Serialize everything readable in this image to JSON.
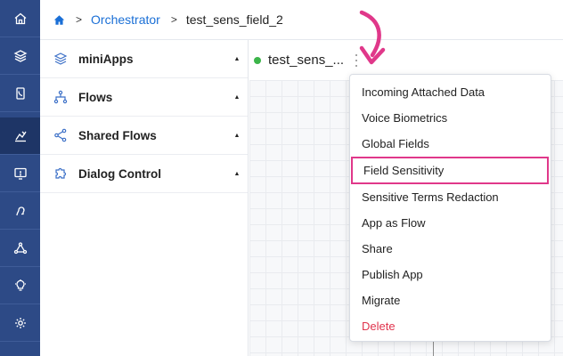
{
  "rail": {
    "items": [
      {
        "icon": "home-icon",
        "active": false
      },
      {
        "icon": "layers-icon",
        "active": false
      },
      {
        "icon": "phone-book-icon",
        "active": false
      },
      {
        "icon": "chart-edit-icon",
        "active": true
      },
      {
        "icon": "monitor-message-icon",
        "active": false
      },
      {
        "icon": "voice-profile-icon",
        "active": false
      },
      {
        "icon": "network-icon",
        "active": false
      },
      {
        "icon": "lightbulb-icon",
        "active": false
      },
      {
        "icon": "settings-cog-icon",
        "active": false
      }
    ]
  },
  "breadcrumb": {
    "home_icon": "home-icon",
    "separator": ">",
    "link": "Orchestrator",
    "current": "test_sens_field_2"
  },
  "panel": {
    "items": [
      {
        "label": "miniApps",
        "icon": "stack-icon",
        "caret": "▲"
      },
      {
        "label": "Flows",
        "icon": "flow-icon",
        "caret": "▲"
      },
      {
        "label": "Shared Flows",
        "icon": "share-icon",
        "caret": "▲"
      },
      {
        "label": "Dialog Control",
        "icon": "puzzle-icon",
        "caret": "▲"
      }
    ]
  },
  "app": {
    "title": "test_sens_...",
    "status_color": "#3cb54a"
  },
  "menu": {
    "items": [
      {
        "label": "Incoming Attached Data"
      },
      {
        "label": "Voice Biometrics"
      },
      {
        "label": "Global Fields"
      },
      {
        "label": "Field Sensitivity",
        "highlighted": true
      },
      {
        "label": "Sensitive Terms Redaction"
      },
      {
        "label": "App as Flow"
      },
      {
        "label": "Share"
      },
      {
        "label": "Publish App"
      },
      {
        "label": "Migrate"
      },
      {
        "label": "Delete",
        "danger": true
      }
    ]
  },
  "colors": {
    "rail_bg": "#2d4a86",
    "link": "#1a6fd6",
    "highlight_border": "#e0388a",
    "danger": "#e0344d"
  }
}
